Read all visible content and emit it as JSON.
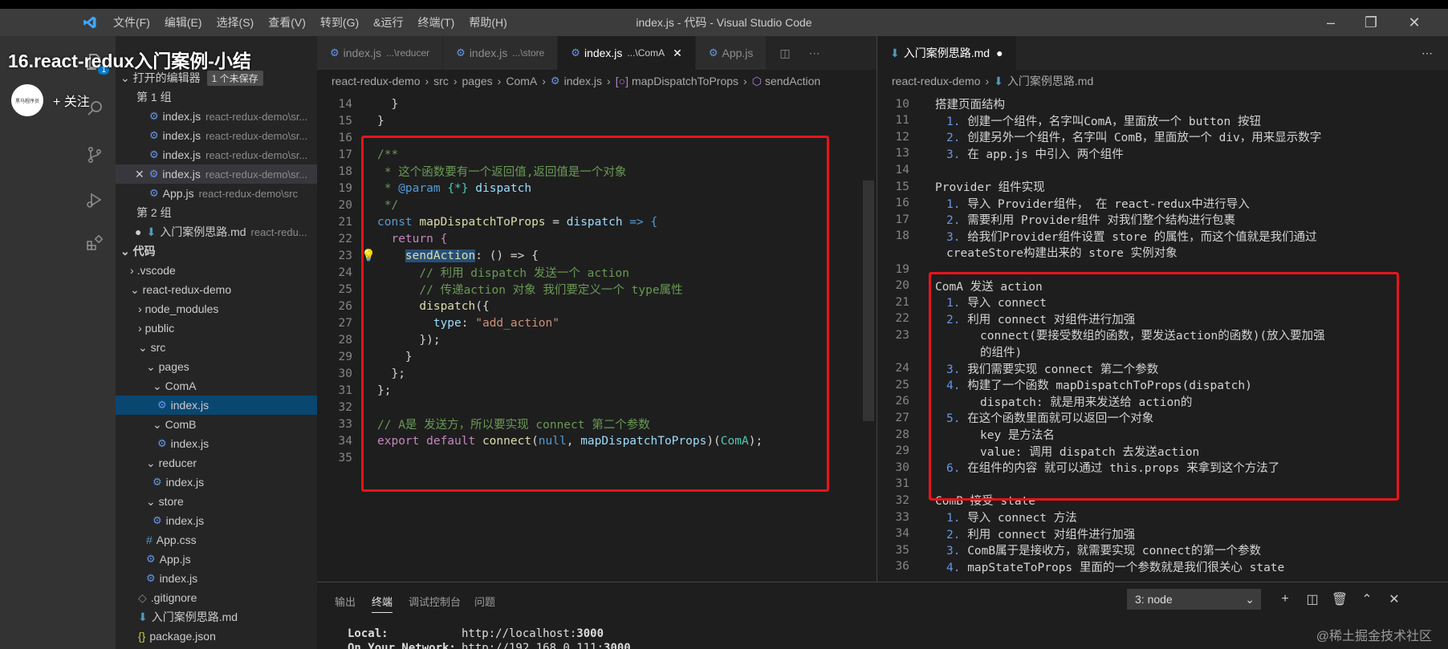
{
  "overlay": {
    "title": "16.react-redux入门案例-小结",
    "follow": "+ 关注",
    "avatar_text": "黑马程序员"
  },
  "titlebar": {
    "menus": [
      "文件(F)",
      "编辑(E)",
      "选择(S)",
      "查看(V)",
      "转到(G)",
      "&运行",
      "终端(T)",
      "帮助(H)"
    ],
    "title": "index.js - 代码 - Visual Studio Code"
  },
  "activity_badge": "1",
  "sidebar": {
    "open_editors_header": "打开的编辑器",
    "unsaved_badge": "1 个未保存",
    "group1": "第 1 组",
    "group2": "第 2 组",
    "open_items": [
      {
        "name": "index.js",
        "path": "react-redux-demo\\sr..."
      },
      {
        "name": "index.js",
        "path": "react-redux-demo\\sr..."
      },
      {
        "name": "index.js",
        "path": "react-redux-demo\\sr..."
      },
      {
        "name": "index.js",
        "path": "react-redux-demo\\sr..."
      },
      {
        "name": "App.js",
        "path": "react-redux-demo\\src"
      }
    ],
    "group2_item": {
      "name": "入门案例思路.md",
      "path": "react-redu..."
    },
    "folder_header": "代码",
    "tree": [
      ".vscode",
      "react-redux-demo",
      "node_modules",
      "public",
      "src",
      "pages",
      "ComA",
      "index.js",
      "ComB",
      "index.js",
      "reducer",
      "index.js",
      "store",
      "index.js",
      "App.css",
      "App.js",
      "index.js",
      ".gitignore",
      "入门案例思路.md",
      "package.json"
    ]
  },
  "editor1": {
    "tabs": [
      {
        "name": "index.js",
        "sub": "...\\reducer"
      },
      {
        "name": "index.js",
        "sub": "...\\store"
      },
      {
        "name": "index.js",
        "sub": "...\\ComA"
      },
      {
        "name": "App.js",
        "sub": ""
      }
    ],
    "breadcrumb": [
      "react-redux-demo",
      "src",
      "pages",
      "ComA",
      "index.js",
      "mapDispatchToProps",
      "sendAction"
    ],
    "line_numbers": [
      "14",
      "15",
      "16",
      "17",
      "18",
      "19",
      "20",
      "21",
      "22",
      "23",
      "24",
      "25",
      "26",
      "27",
      "28",
      "29",
      "30",
      "31",
      "32",
      "33",
      "34",
      "35"
    ],
    "code": {
      "l14": "  }",
      "l15": "}",
      "l17": "/**",
      "l18": " * 这个函数要有一个返回值,返回值是一个对象",
      "l19_a": " * ",
      "l19_b": "@param",
      "l19_c": " {*} ",
      "l19_d": "dispatch",
      "l20": " */",
      "l21_kw": "const ",
      "l21_fn": "mapDispatchToProps",
      "l21_eq": " = ",
      "l21_var": "dispatch",
      "l21_arrow": " => {",
      "l22_kw": "  return ",
      "l22_b": "{",
      "l23_fn": "sendAction",
      "l23_rest": ": () => {",
      "l24": "      // 利用 dispatch 发送一个 action",
      "l25": "      // 传递action 对象 我们要定义一个 type属性",
      "l26_fn": "      dispatch",
      "l26_rest": "({",
      "l27_key": "        type",
      "l27_colon": ": ",
      "l27_str": "\"add_action\"",
      "l28": "      });",
      "l29": "    }",
      "l30": "  };",
      "l31": "};",
      "l33": "// A是 发送方，所以要实现 connect 第二个参数",
      "l34_kw": "export default ",
      "l34_fn": "connect",
      "l34_a": "(",
      "l34_null": "null",
      "l34_b": ", ",
      "l34_var": "mapDispatchToProps",
      "l34_c": ")(",
      "l34_cls": "ComA",
      "l34_d": ");"
    }
  },
  "editor2": {
    "tab": "入门案例思路.md",
    "breadcrumb": [
      "react-redux-demo",
      "入门案例思路.md"
    ],
    "lines": [
      {
        "n": "10",
        "t": "搭建页面结构",
        "indent": 0
      },
      {
        "n": "11",
        "num": "1.",
        "t": "创建一个组件，名字叫ComA，里面放一个 button 按钮",
        "indent": 1
      },
      {
        "n": "12",
        "num": "2.",
        "t": "创建另外一个组件，名字叫 ComB，里面放一个 div，用来显示数字",
        "indent": 1
      },
      {
        "n": "13",
        "num": "3.",
        "t": "在 app.js 中引入 两个组件",
        "indent": 1
      },
      {
        "n": "14",
        "t": "",
        "indent": 0
      },
      {
        "n": "15",
        "t": "Provider 组件实现",
        "indent": 0
      },
      {
        "n": "16",
        "num": "1.",
        "t": "导入 Provider组件， 在 react-redux中进行导入",
        "indent": 1
      },
      {
        "n": "17",
        "num": "2.",
        "t": "需要利用 Provider组件 对我们整个结构进行包裹",
        "indent": 1
      },
      {
        "n": "18",
        "num": "3.",
        "t": "给我们Provider组件设置 store 的属性，而这个值就是我们通过",
        "indent": 1
      },
      {
        "n": "",
        "t": "createStore构建出来的 store 实例对象",
        "indent": 1
      },
      {
        "n": "19",
        "t": "",
        "indent": 0
      },
      {
        "n": "20",
        "t": "ComA 发送 action",
        "indent": 0
      },
      {
        "n": "21",
        "num": "1.",
        "t": "导入 connect",
        "indent": 1
      },
      {
        "n": "22",
        "num": "2.",
        "t": "利用 connect 对组件进行加强",
        "indent": 1
      },
      {
        "n": "23",
        "t": "connect(要接受数组的函数，要发送action的函数)(放入要加强",
        "indent": 3
      },
      {
        "n": "",
        "t": "的组件)",
        "indent": 3
      },
      {
        "n": "24",
        "num": "3.",
        "t": "我们需要实现 connect 第二个参数",
        "indent": 1
      },
      {
        "n": "25",
        "num": "4.",
        "t": "构建了一个函数 mapDispatchToProps(dispatch)",
        "indent": 1
      },
      {
        "n": "26",
        "t": "dispatch: 就是用来发送给 action的",
        "indent": 2
      },
      {
        "n": "27",
        "num": "5.",
        "t": "在这个函数里面就可以返回一个对象",
        "indent": 1
      },
      {
        "n": "28",
        "t": "key 是方法名",
        "indent": 3
      },
      {
        "n": "29",
        "t": "value: 调用 dispatch 去发送action",
        "indent": 3
      },
      {
        "n": "30",
        "num": "6.",
        "t": "在组件的内容 就可以通过 this.props 来拿到这个方法了",
        "indent": 1
      },
      {
        "n": "31",
        "t": "",
        "indent": 0
      },
      {
        "n": "32",
        "t": "ComB 接受 state",
        "indent": 0
      },
      {
        "n": "33",
        "num": "1.",
        "t": "导入 connect 方法",
        "indent": 1
      },
      {
        "n": "34",
        "num": "2.",
        "t": "利用 connect 对组件进行加强",
        "indent": 1
      },
      {
        "n": "35",
        "num": "3.",
        "t": "ComB属于是接收方，就需要实现 connect的第一个参数",
        "indent": 1
      },
      {
        "n": "36",
        "num": "4.",
        "t": "mapStateToProps 里面的一个参数就是我们很关心 state",
        "indent": 1
      }
    ]
  },
  "panel": {
    "tabs": [
      "输出",
      "终端",
      "调试控制台",
      "问题"
    ],
    "terminal_select": "3: node",
    "term": [
      {
        "label": "Local:",
        "value": "http://localhost:",
        "port": "3000"
      },
      {
        "label": "On Your Network:",
        "value": "http://192.168.0.111:",
        "port": "3000"
      }
    ]
  },
  "watermark": "@稀土掘金技术社区",
  "colors": {
    "highlight_box": "#e8141a",
    "accent": "#007acc"
  }
}
